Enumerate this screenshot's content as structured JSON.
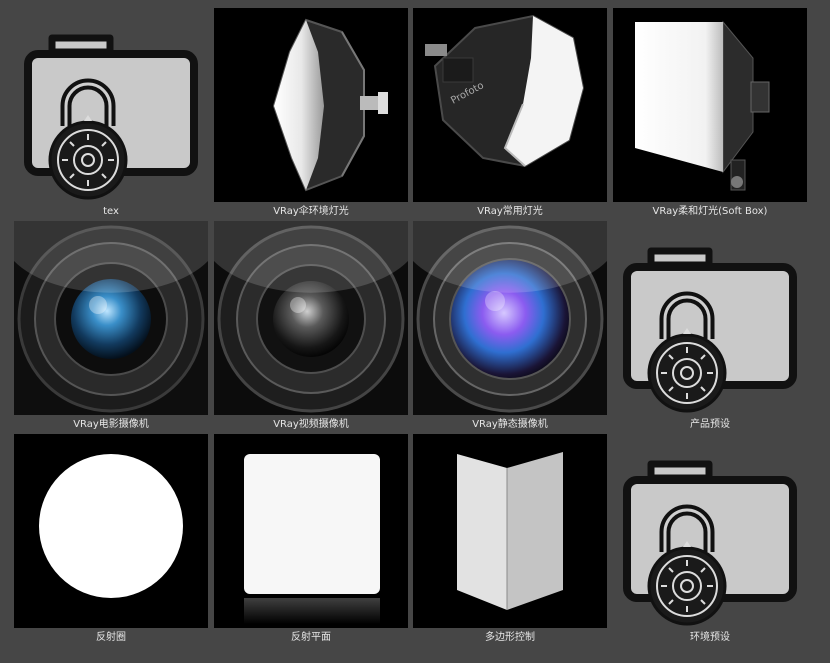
{
  "window": {
    "title": ""
  },
  "tiles": [
    {
      "label": "tex",
      "icon": "locked-folder-icon"
    },
    {
      "label": "VRay伞环境灯光",
      "icon": "octagon-softbox-side-icon"
    },
    {
      "label": "VRay常用灯光",
      "icon": "octagon-softbox-icon"
    },
    {
      "label": "VRay柔和灯光(Soft Box)",
      "icon": "square-softbox-icon"
    },
    {
      "label": "VRay电影摄像机",
      "icon": "camera-lens-blue-icon"
    },
    {
      "label": "VRay视频摄像机",
      "icon": "camera-lens-dark-icon"
    },
    {
      "label": "VRay静态摄像机",
      "icon": "camera-lens-violet-icon"
    },
    {
      "label": "产品预设",
      "icon": "locked-folder-icon"
    },
    {
      "label": "反射圈",
      "icon": "reflector-disc-icon"
    },
    {
      "label": "反射平面",
      "icon": "reflector-plane-icon"
    },
    {
      "label": "多边形控制",
      "icon": "folding-panel-icon"
    },
    {
      "label": "环境预设",
      "icon": "locked-folder-icon"
    }
  ],
  "colors": {
    "background": "#464646",
    "caption_text": "#e6e6e6",
    "thumb_black": "#000000",
    "folder_fill": "#c9c9c9",
    "folder_stroke": "#111111"
  }
}
